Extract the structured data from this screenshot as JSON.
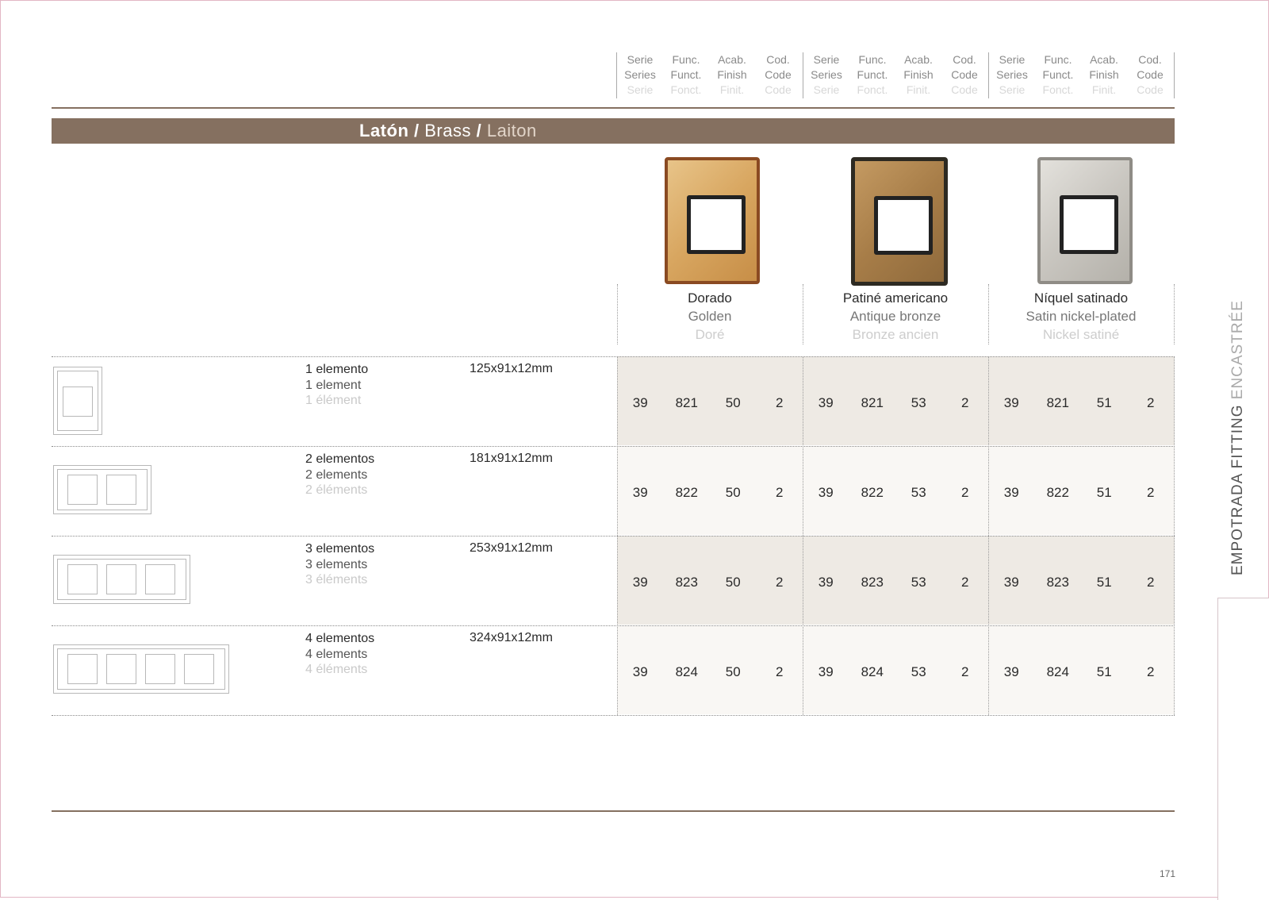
{
  "header": {
    "groups": [
      [
        {
          "es": "Serie",
          "en": "Series",
          "fr": "Serie"
        },
        {
          "es": "Func.",
          "en": "Funct.",
          "fr": "Fonct."
        },
        {
          "es": "Acab.",
          "en": "Finish",
          "fr": "Finit."
        },
        {
          "es": "Cod.",
          "en": "Code",
          "fr": "Code"
        }
      ],
      [
        {
          "es": "Serie",
          "en": "Series",
          "fr": "Serie"
        },
        {
          "es": "Func.",
          "en": "Funct.",
          "fr": "Fonct."
        },
        {
          "es": "Acab.",
          "en": "Finish",
          "fr": "Finit."
        },
        {
          "es": "Cod.",
          "en": "Code",
          "fr": "Code"
        }
      ],
      [
        {
          "es": "Serie",
          "en": "Series",
          "fr": "Serie"
        },
        {
          "es": "Func.",
          "en": "Funct.",
          "fr": "Fonct."
        },
        {
          "es": "Acab.",
          "en": "Finish",
          "fr": "Finit."
        },
        {
          "es": "Cod.",
          "en": "Code",
          "fr": "Code"
        }
      ]
    ]
  },
  "section": {
    "es": "Latón",
    "sep1": " / ",
    "en": "Brass",
    "sep2": " / ",
    "fr": "Laiton",
    "band_color": "#857060"
  },
  "finishes": [
    {
      "es": "Dorado",
      "en": "Golden",
      "fr": "Doré"
    },
    {
      "es": "Patiné americano",
      "en": "Antique bronze",
      "fr": "Bronze ancien"
    },
    {
      "es": "Níquel satinado",
      "en": "Satin nickel-plated",
      "fr": "Nickel satiné"
    }
  ],
  "rows": [
    {
      "es": "1 elemento",
      "en": "1 element",
      "fr": "1 élément",
      "dims": "125x91x12mm",
      "codes": [
        [
          "39",
          "821",
          "50",
          "2"
        ],
        [
          "39",
          "821",
          "53",
          "2"
        ],
        [
          "39",
          "821",
          "51",
          "2"
        ]
      ]
    },
    {
      "es": "2 elementos",
      "en": "2 elements",
      "fr": "2 éléments",
      "dims": "181x91x12mm",
      "codes": [
        [
          "39",
          "822",
          "50",
          "2"
        ],
        [
          "39",
          "822",
          "53",
          "2"
        ],
        [
          "39",
          "822",
          "51",
          "2"
        ]
      ]
    },
    {
      "es": "3 elementos",
      "en": "3 elements",
      "fr": "3 éléments",
      "dims": "253x91x12mm",
      "codes": [
        [
          "39",
          "823",
          "50",
          "2"
        ],
        [
          "39",
          "823",
          "53",
          "2"
        ],
        [
          "39",
          "823",
          "51",
          "2"
        ]
      ]
    },
    {
      "es": "4 elementos",
      "en": "4 elements",
      "fr": "4 éléments",
      "dims": "324x91x12mm",
      "codes": [
        [
          "39",
          "824",
          "50",
          "2"
        ],
        [
          "39",
          "824",
          "53",
          "2"
        ],
        [
          "39",
          "824",
          "51",
          "2"
        ]
      ]
    }
  ],
  "side_tab": {
    "es": "EMPOTRADA",
    "en": "FITTING",
    "fr": "ENCASTRÉE"
  },
  "page_number": "171"
}
